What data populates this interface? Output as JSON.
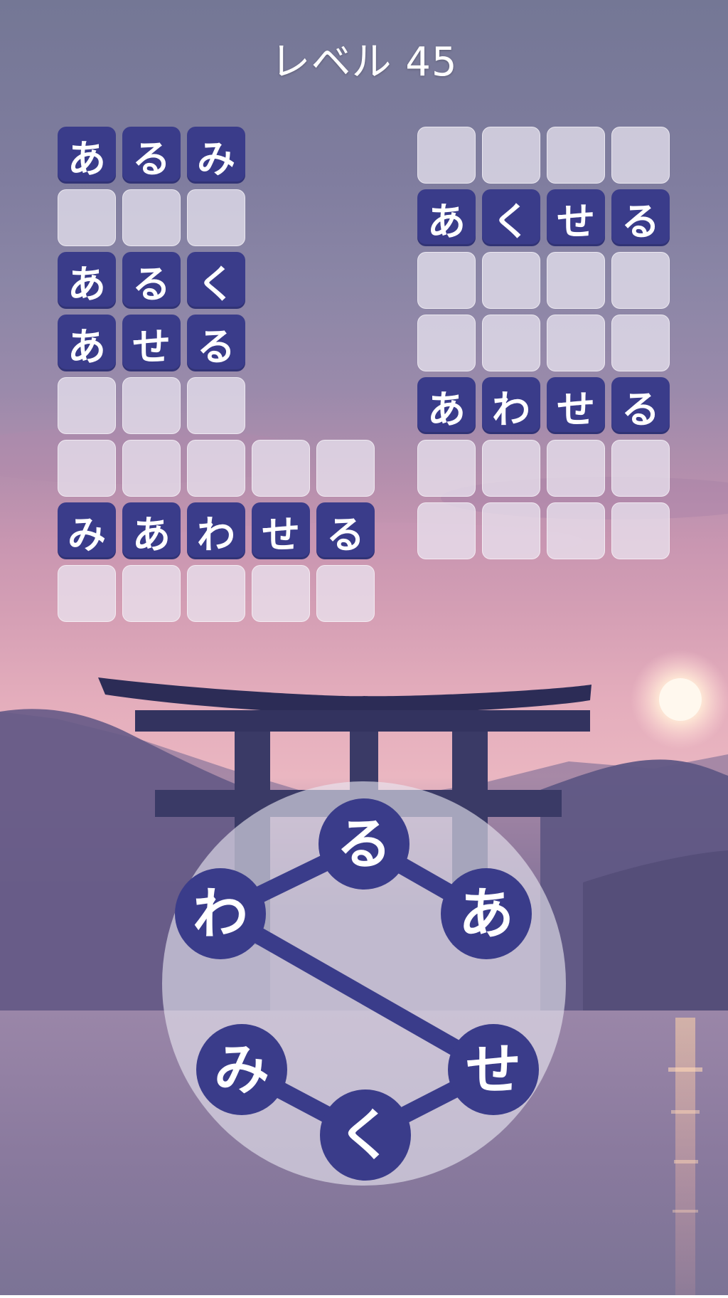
{
  "title": "レベル 45",
  "colors": {
    "tile_filled": "#3a3c8a",
    "tile_empty": "#ebe8f2",
    "wheel_letter_bg": "#3a3c8a",
    "text": "#ffffff"
  },
  "left_grid": {
    "rows": [
      {
        "letters": [
          "あ",
          "る",
          "み"
        ],
        "solved": true
      },
      {
        "letters": [
          "",
          "",
          ""
        ],
        "solved": false
      },
      {
        "letters": [
          "あ",
          "る",
          "く"
        ],
        "solved": true
      },
      {
        "letters": [
          "あ",
          "せ",
          "る"
        ],
        "solved": true
      },
      {
        "letters": [
          "",
          "",
          ""
        ],
        "solved": false
      },
      {
        "letters": [
          "",
          "",
          "",
          "",
          ""
        ],
        "solved": false
      },
      {
        "letters": [
          "み",
          "あ",
          "わ",
          "せ",
          "る"
        ],
        "solved": true
      },
      {
        "letters": [
          "",
          "",
          "",
          "",
          ""
        ],
        "solved": false
      }
    ]
  },
  "right_grid": {
    "rows": [
      {
        "letters": [
          "",
          "",
          "",
          ""
        ],
        "solved": false
      },
      {
        "letters": [
          "あ",
          "く",
          "せ",
          "る"
        ],
        "solved": true
      },
      {
        "letters": [
          "",
          "",
          "",
          ""
        ],
        "solved": false
      },
      {
        "letters": [
          "",
          "",
          "",
          ""
        ],
        "solved": false
      },
      {
        "letters": [
          "あ",
          "わ",
          "せ",
          "る"
        ],
        "solved": true
      },
      {
        "letters": [
          "",
          "",
          "",
          ""
        ],
        "solved": false
      },
      {
        "letters": [
          "",
          "",
          "",
          ""
        ],
        "solved": false
      }
    ]
  },
  "wheel": {
    "letters": [
      "る",
      "あ",
      "せ",
      "く",
      "み",
      "わ"
    ]
  }
}
